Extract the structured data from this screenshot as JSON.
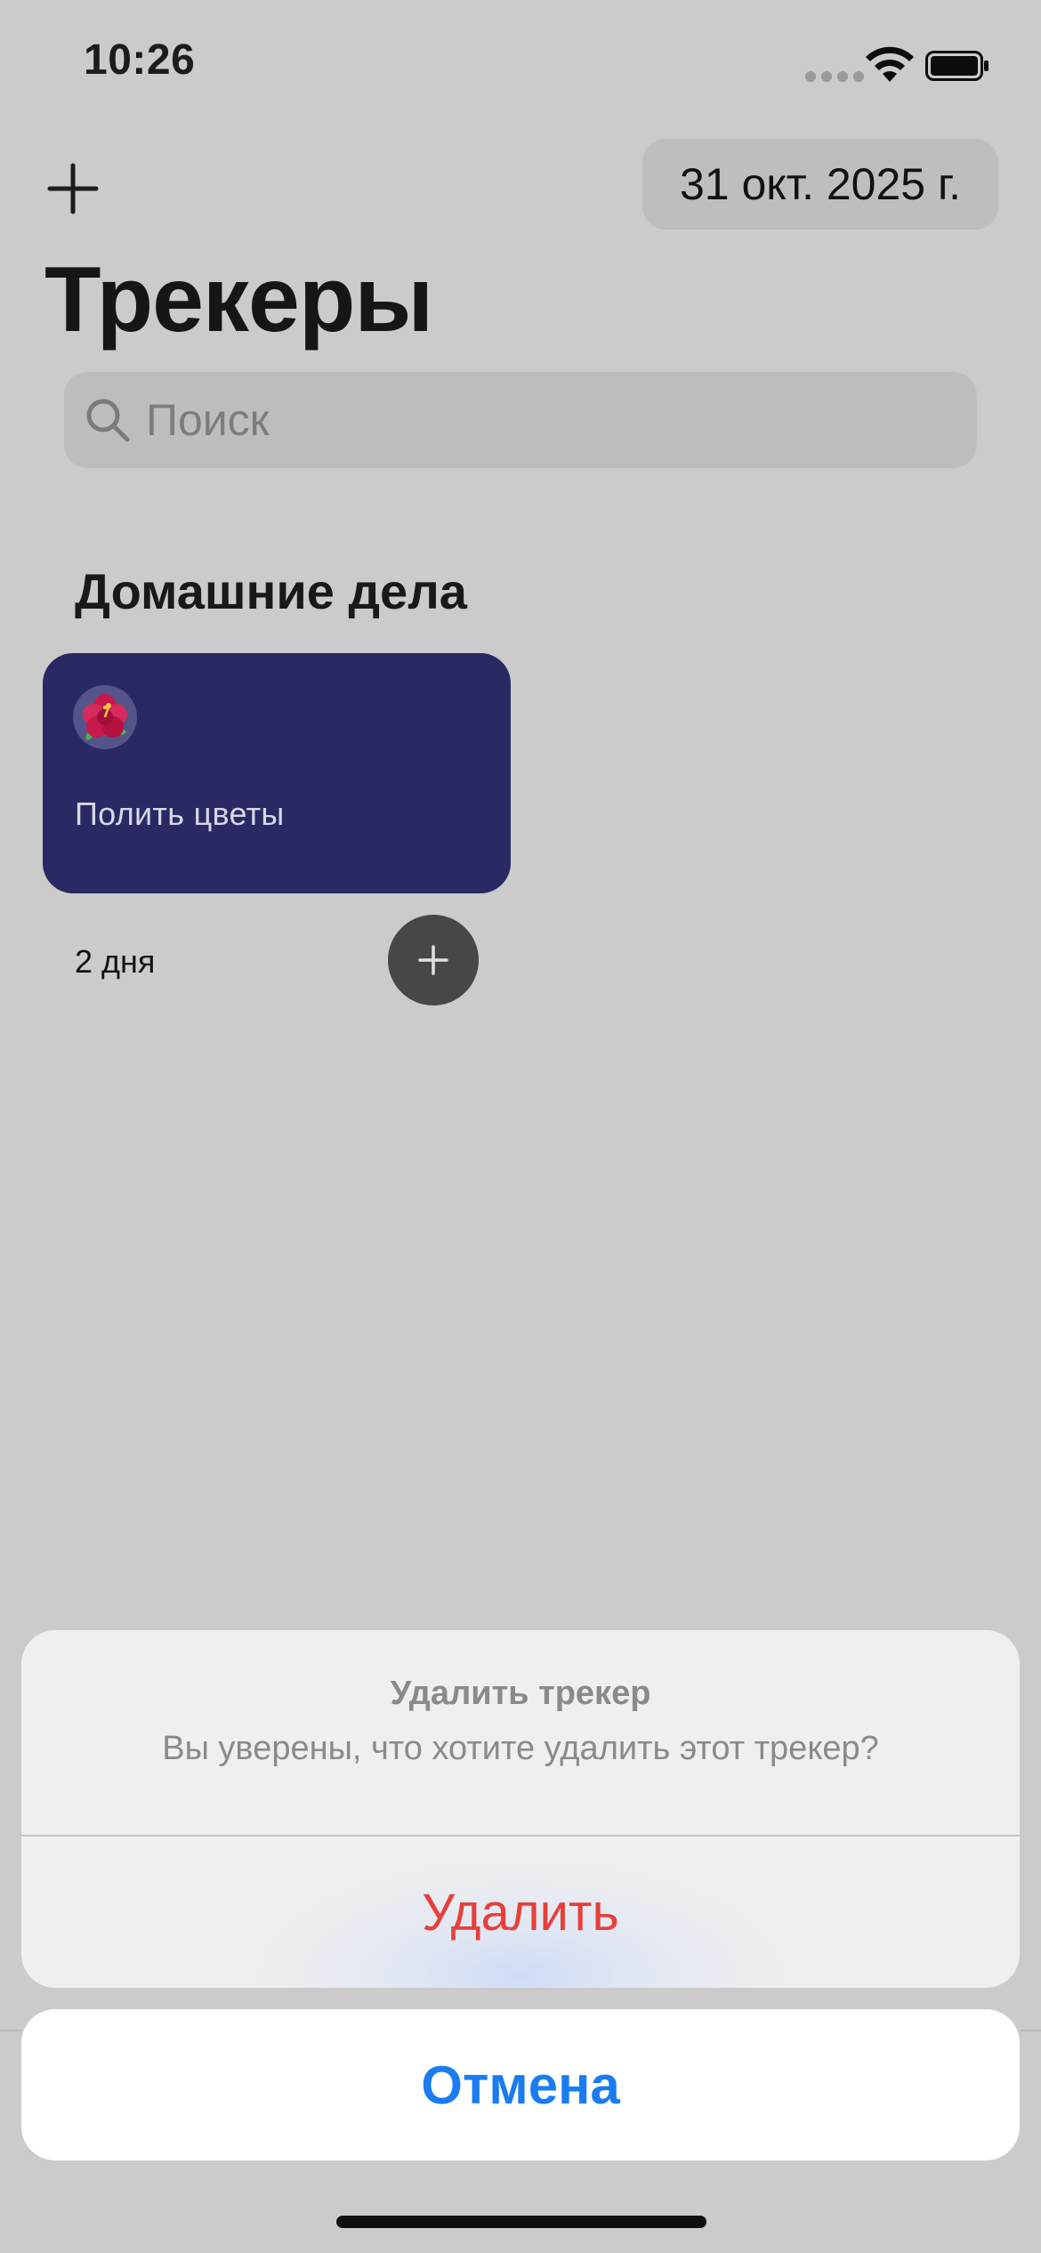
{
  "status_bar": {
    "time": "10:26"
  },
  "header": {
    "date": "31 окт. 2025 г.",
    "title": "Трекеры"
  },
  "search": {
    "placeholder": "Поиск",
    "value": ""
  },
  "category": {
    "title": "Домашние дела",
    "trackers": [
      {
        "emoji": "🌺",
        "name": "Полить цветы",
        "days": "2 дня",
        "card_color": "#2a2963"
      }
    ]
  },
  "action_sheet": {
    "title": "Удалить трекер",
    "message": "Вы уверены, что хотите удалить этот трекер?",
    "delete_label": "Удалить",
    "cancel_label": "Отмена"
  },
  "colors": {
    "accent": "#1a7cf0",
    "destructive": "#e5403a",
    "card": "#2a2963",
    "background": "#cbcbcb"
  },
  "icons": [
    "plus-icon",
    "search-icon",
    "wifi-icon",
    "battery-icon",
    "cellular-signal-icon",
    "plus-circle-icon"
  ]
}
